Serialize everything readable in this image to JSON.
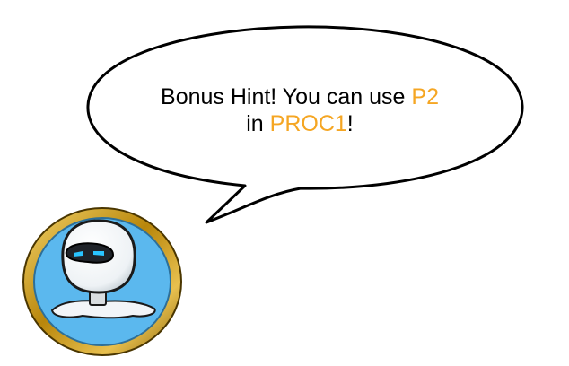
{
  "dialog": {
    "line1": {
      "prefix": "Bonus Hint! You can use ",
      "keyword": "P2"
    },
    "line2": {
      "prefix": "in ",
      "keyword": "PROC1",
      "suffix": "!"
    }
  },
  "colors": {
    "keyword": "#f5a623",
    "medallion_rim": "#d4a017",
    "medallion_fill": "#5bb8ee",
    "robot_eyes": "#29c4ff"
  },
  "avatar": {
    "icon": "robot-icon"
  }
}
